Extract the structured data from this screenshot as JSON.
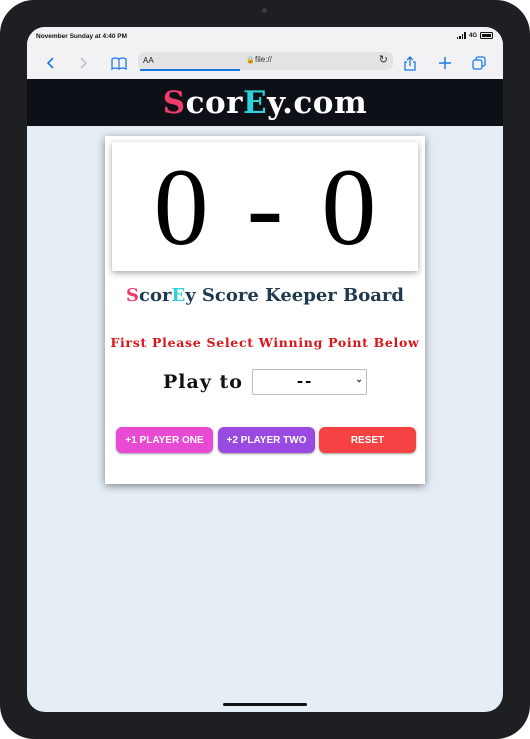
{
  "status_bar": {
    "time": "November Sunday at 4:40 PM",
    "network": "4G"
  },
  "browser": {
    "text_size_label": "AA",
    "url": "file://"
  },
  "site": {
    "logo_parts": [
      "S",
      "cor",
      "E",
      "y.com"
    ]
  },
  "scoreboard": {
    "player_one_score": "0",
    "separator": "-",
    "player_two_score": "0",
    "title_parts": [
      "S",
      "cor",
      "E",
      "y Score Keeper Board"
    ],
    "instruction": "First Please Select Winning Point Below",
    "play_to_label": "Play to",
    "winning_point": {
      "selected": "--"
    },
    "buttons": {
      "player_one": "+1 PLAYER ONE",
      "player_two": "+2 PLAYER TWO",
      "reset": "RESET"
    }
  },
  "colors": {
    "header_bg": "#0d1117",
    "logo_pink": "#ee3d6a",
    "logo_teal": "#2fd1d9",
    "instruction_red": "#d9141b",
    "button_player_one": "#e84ad3",
    "button_player_two": "#9a4ae2",
    "button_reset": "#f64242",
    "page_bg": "#e5edf5"
  }
}
